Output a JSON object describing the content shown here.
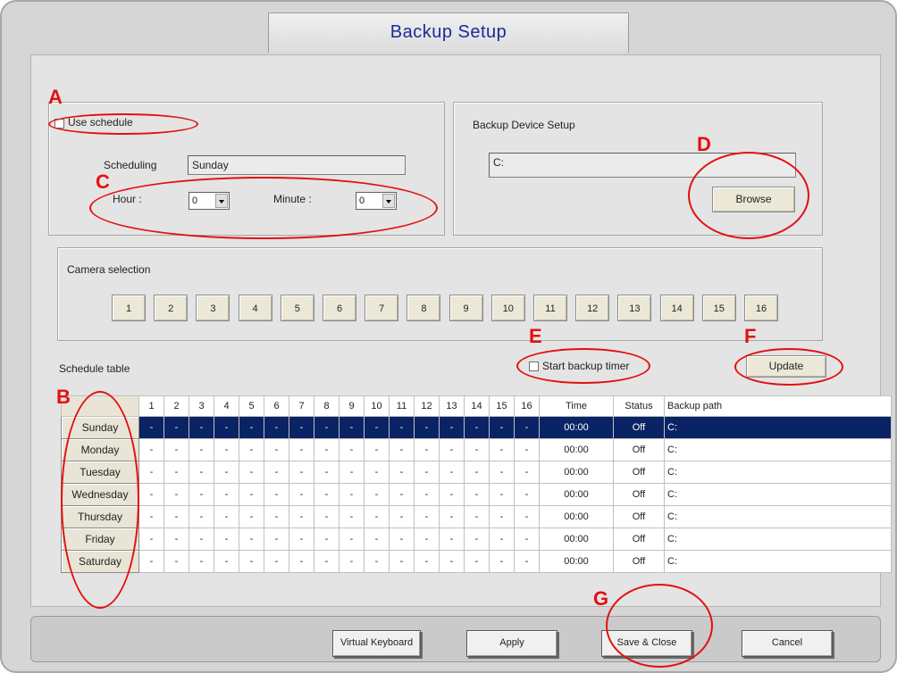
{
  "window": {
    "title": "Backup Setup"
  },
  "schedule_group": {
    "use_schedule_label": "Use schedule",
    "scheduling_label": "Scheduling",
    "scheduling_value": "Sunday",
    "hour_label": "Hour :",
    "hour_value": "0",
    "minute_label": "Minute :",
    "minute_value": "0"
  },
  "device_group": {
    "title": "Backup Device Setup",
    "path_value": "C:",
    "browse_label": "Browse"
  },
  "camera_group": {
    "title": "Camera selection",
    "cameras": [
      "1",
      "2",
      "3",
      "4",
      "5",
      "6",
      "7",
      "8",
      "9",
      "10",
      "11",
      "12",
      "13",
      "14",
      "15",
      "16"
    ]
  },
  "schedule_table": {
    "title": "Schedule table",
    "start_timer_label": "Start backup timer",
    "update_label": "Update",
    "headers": {
      "channels": [
        "1",
        "2",
        "3",
        "4",
        "5",
        "6",
        "7",
        "8",
        "9",
        "10",
        "11",
        "12",
        "13",
        "14",
        "15",
        "16"
      ],
      "time": "Time",
      "status": "Status",
      "path": "Backup path"
    },
    "rows": [
      {
        "day": "Sunday",
        "channels": [
          "-",
          "-",
          "-",
          "-",
          "-",
          "-",
          "-",
          "-",
          "-",
          "-",
          "-",
          "-",
          "-",
          "-",
          "-",
          "-"
        ],
        "time": "00:00",
        "status": "Off",
        "path": "C:",
        "selected": true
      },
      {
        "day": "Monday",
        "channels": [
          "-",
          "-",
          "-",
          "-",
          "-",
          "-",
          "-",
          "-",
          "-",
          "-",
          "-",
          "-",
          "-",
          "-",
          "-",
          "-"
        ],
        "time": "00:00",
        "status": "Off",
        "path": "C:"
      },
      {
        "day": "Tuesday",
        "channels": [
          "-",
          "-",
          "-",
          "-",
          "-",
          "-",
          "-",
          "-",
          "-",
          "-",
          "-",
          "-",
          "-",
          "-",
          "-",
          "-"
        ],
        "time": "00:00",
        "status": "Off",
        "path": "C:"
      },
      {
        "day": "Wednesday",
        "channels": [
          "-",
          "-",
          "-",
          "-",
          "-",
          "-",
          "-",
          "-",
          "-",
          "-",
          "-",
          "-",
          "-",
          "-",
          "-",
          "-"
        ],
        "time": "00:00",
        "status": "Off",
        "path": "C:"
      },
      {
        "day": "Thursday",
        "channels": [
          "-",
          "-",
          "-",
          "-",
          "-",
          "-",
          "-",
          "-",
          "-",
          "-",
          "-",
          "-",
          "-",
          "-",
          "-",
          "-"
        ],
        "time": "00:00",
        "status": "Off",
        "path": "C:"
      },
      {
        "day": "Friday",
        "channels": [
          "-",
          "-",
          "-",
          "-",
          "-",
          "-",
          "-",
          "-",
          "-",
          "-",
          "-",
          "-",
          "-",
          "-",
          "-",
          "-"
        ],
        "time": "00:00",
        "status": "Off",
        "path": "C:"
      },
      {
        "day": "Saturday",
        "channels": [
          "-",
          "-",
          "-",
          "-",
          "-",
          "-",
          "-",
          "-",
          "-",
          "-",
          "-",
          "-",
          "-",
          "-",
          "-",
          "-"
        ],
        "time": "00:00",
        "status": "Off",
        "path": "C:"
      }
    ]
  },
  "bottom_bar": {
    "virtual_keyboard": "Virtual Keyboard",
    "apply": "Apply",
    "save_close": "Save & Close",
    "cancel": "Cancel"
  },
  "annotations": [
    "A",
    "B",
    "C",
    "D",
    "E",
    "F",
    "G"
  ],
  "colors": {
    "title": "#1a2a9a",
    "selected_row": "#0a2364",
    "annotation": "#e31010"
  }
}
